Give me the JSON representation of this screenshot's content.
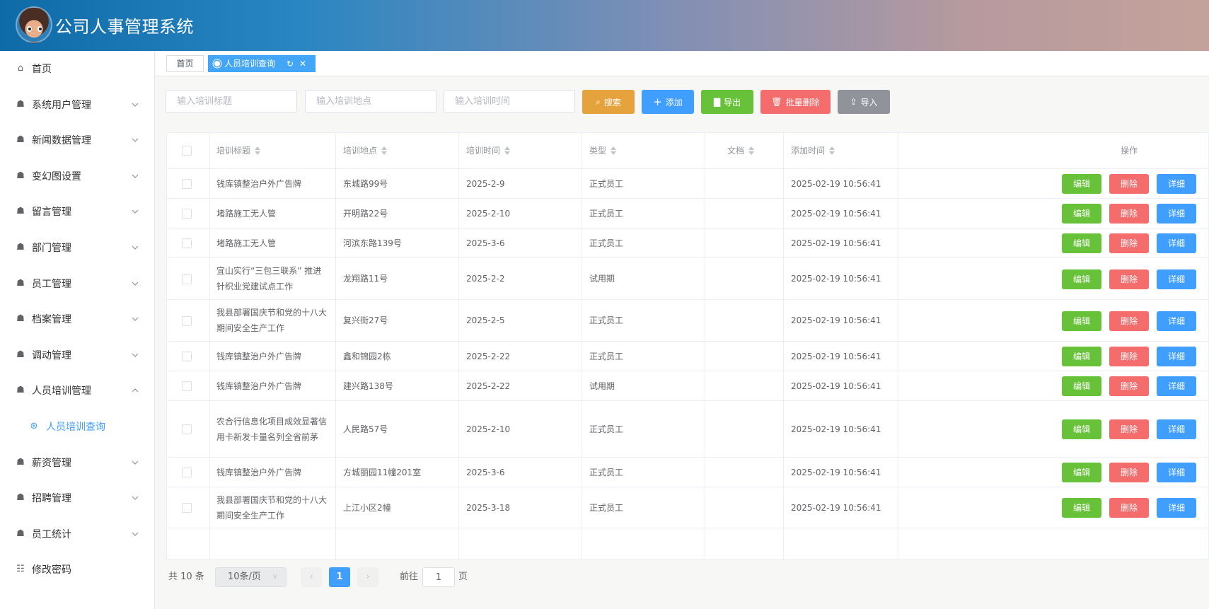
{
  "app": {
    "title": "公司人事管理系统"
  },
  "sidebar": {
    "items": [
      {
        "label": "首页",
        "icon": "home-icon",
        "chevron": ""
      },
      {
        "label": "系统用户管理",
        "icon": "menu-icon",
        "chevron": "down"
      },
      {
        "label": "新闻数据管理",
        "icon": "menu-icon",
        "chevron": "down"
      },
      {
        "label": "变幻图设置",
        "icon": "menu-icon",
        "chevron": "down"
      },
      {
        "label": "留言管理",
        "icon": "menu-icon",
        "chevron": "down"
      },
      {
        "label": "部门管理",
        "icon": "menu-icon",
        "chevron": "down"
      },
      {
        "label": "员工管理",
        "icon": "menu-icon",
        "chevron": "down"
      },
      {
        "label": "档案管理",
        "icon": "menu-icon",
        "chevron": "down"
      },
      {
        "label": "调动管理",
        "icon": "menu-icon",
        "chevron": "down"
      },
      {
        "label": "人员培训管理",
        "icon": "menu-icon",
        "chevron": "up"
      },
      {
        "label": "人员培训查询",
        "icon": "compass-icon",
        "chevron": "",
        "sub": true,
        "active": true
      },
      {
        "label": "薪资管理",
        "icon": "menu-icon",
        "chevron": "down"
      },
      {
        "label": "招聘管理",
        "icon": "menu-icon",
        "chevron": "down"
      },
      {
        "label": "员工统计",
        "icon": "menu-icon",
        "chevron": "down"
      },
      {
        "label": "修改密码",
        "icon": "grid-icon",
        "chevron": ""
      }
    ]
  },
  "tabs": [
    {
      "label": "首页",
      "active": false
    },
    {
      "label": "人员培训查询",
      "active": true
    }
  ],
  "search": {
    "title_placeholder": "输入培训标题",
    "place_placeholder": "输入培训地点",
    "time_placeholder": "输入培训时间",
    "buttons": {
      "search": "搜索",
      "add": "添加",
      "export": "导出",
      "batch_delete": "批量删除",
      "import": "导入"
    }
  },
  "colors": {
    "search": "#e6a23c",
    "add": "#409eff",
    "export": "#67c23a",
    "batch_delete": "#f56c6c",
    "import": "#909399"
  },
  "table": {
    "headers": {
      "title": "培训标题",
      "place": "培训地点",
      "time": "培训时间",
      "type": "类型",
      "doc": "文档",
      "added": "添加时间",
      "ops": "操作"
    },
    "actions": {
      "edit": "编辑",
      "delete": "删除",
      "detail": "详细"
    },
    "rows": [
      {
        "title": "钱库镇整治户外广告牌",
        "place": "东城路99号",
        "time": "2025-2-9",
        "type": "正式员工",
        "doc": "",
        "added": "2025-02-19 10:56:41"
      },
      {
        "title": "堵路施工无人管",
        "place": "开明路22号",
        "time": "2025-2-10",
        "type": "正式员工",
        "doc": "",
        "added": "2025-02-19 10:56:41"
      },
      {
        "title": "堵路施工无人管",
        "place": "河滨东路139号",
        "time": "2025-3-6",
        "type": "正式员工",
        "doc": "",
        "added": "2025-02-19 10:56:41"
      },
      {
        "title": "宜山实行“三包三联系” 推进针织业党建试点工作",
        "place": "龙翔路11号",
        "time": "2025-2-2",
        "type": "试用期",
        "doc": "",
        "added": "2025-02-19 10:56:41"
      },
      {
        "title": "我县部署国庆节和党的十八大期间安全生产工作",
        "place": "复兴街27号",
        "time": "2025-2-5",
        "type": "正式员工",
        "doc": "",
        "added": "2025-02-19 10:56:41"
      },
      {
        "title": "钱库镇整治户外广告牌",
        "place": "鑫和锦园2栋",
        "time": "2025-2-22",
        "type": "正式员工",
        "doc": "",
        "added": "2025-02-19 10:56:41"
      },
      {
        "title": "钱库镇整治户外广告牌",
        "place": "建兴路138号",
        "time": "2025-2-22",
        "type": "试用期",
        "doc": "",
        "added": "2025-02-19 10:56:41"
      },
      {
        "title": "农合行信息化项目成效显著信用卡新发卡量名列全省前茅",
        "place": "人民路57号",
        "time": "2025-2-10",
        "type": "正式员工",
        "doc": "",
        "added": "2025-02-19 10:56:41"
      },
      {
        "title": "钱库镇整治户外广告牌",
        "place": "方城丽园11幢201室",
        "time": "2025-3-6",
        "type": "正式员工",
        "doc": "",
        "added": "2025-02-19 10:56:41"
      },
      {
        "title": "我县部署国庆节和党的十八大期间安全生产工作",
        "place": "上江小区2幢",
        "time": "2025-3-18",
        "type": "正式员工",
        "doc": "",
        "added": "2025-02-19 10:56:41"
      }
    ]
  },
  "pagination": {
    "total": "共 10 条",
    "page_size": "10条/页",
    "current_page": "1",
    "goto_label": "前往",
    "goto_value": "1",
    "page_suffix": "页"
  }
}
